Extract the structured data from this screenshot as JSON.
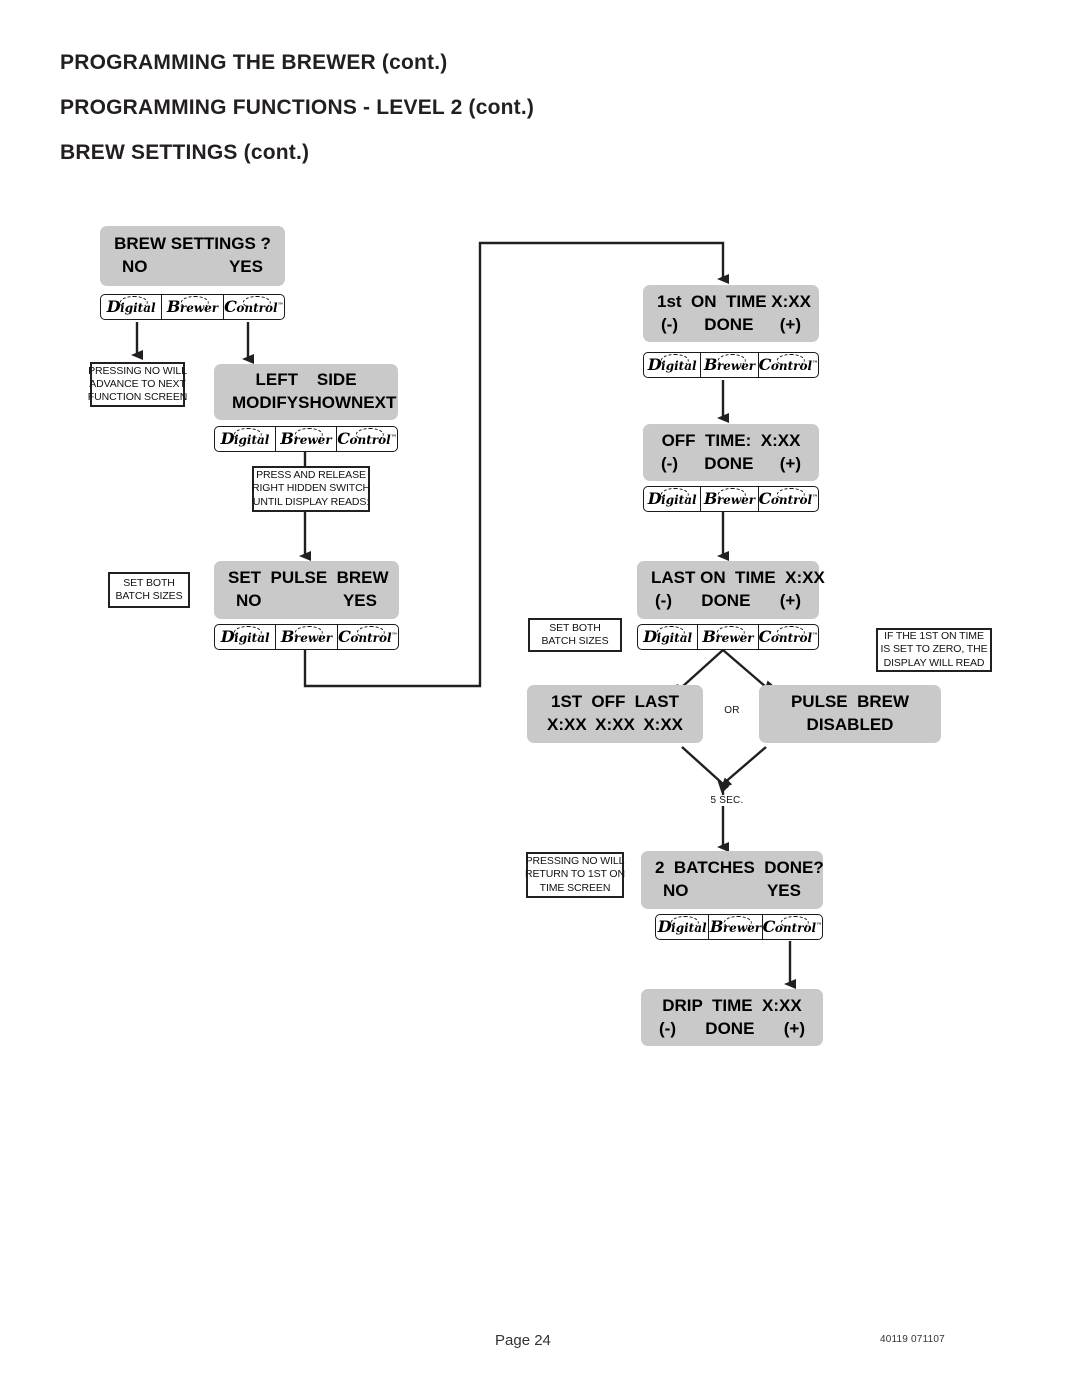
{
  "document": {
    "headings": [
      "PROGRAMMING THE BREWER (cont.)",
      "PROGRAMMING FUNCTIONS - LEVEL  2 (cont.)",
      "BREW SETTINGS (cont.)"
    ],
    "footer": {
      "page_label": "Page 24",
      "doc_code": "40119 071107"
    }
  },
  "logo": {
    "word1_cap": "D",
    "word1_rest": "igital",
    "word2_cap": "B",
    "word2_rest": "rewer",
    "word3_cap": "C",
    "word3_rest": "ontrol",
    "tm": "™"
  },
  "screens": {
    "brew_settings": {
      "line1": "BREW SETTINGS ?",
      "left": "NO",
      "right": "YES"
    },
    "left_side": {
      "line1": "LEFT    SIDE",
      "opt1": "MODIFY",
      "opt2": "SHOW",
      "opt3": "NEXT"
    },
    "set_pulse_brew": {
      "line1": "SET  PULSE  BREW",
      "left": "NO",
      "right": "YES"
    },
    "first_on_time": {
      "line1": "1st  ON  TIME X:XX",
      "minus": "(-)",
      "done": "DONE",
      "plus": "(+)"
    },
    "off_time": {
      "line1": "OFF  TIME:  X:XX",
      "minus": "(-)",
      "done": "DONE",
      "plus": "(+)"
    },
    "last_on_time": {
      "line1": "LAST ON  TIME  X:XX",
      "minus": "(-)",
      "done": "DONE",
      "plus": "(+)"
    },
    "summary_times": {
      "h1": "1ST",
      "h2": "OFF",
      "h3": "LAST",
      "v1": "X:XX",
      "v2": "X:XX",
      "v3": "X:XX"
    },
    "pulse_brew_disabled": {
      "line1": "PULSE  BREW",
      "line2": "DISABLED"
    },
    "two_batches_done": {
      "line1": "2  BATCHES  DONE?",
      "left": "NO",
      "right": "YES"
    },
    "drip_time": {
      "line1": "DRIP  TIME  X:XX",
      "minus": "(-)",
      "done": "DONE",
      "plus": "(+)"
    }
  },
  "notes": {
    "pressing_no_advance": [
      "PRESSING NO WILL",
      "ADVANCE TO NEXT",
      "FUNCTION SCREEN"
    ],
    "press_release_switch": [
      "PRESS AND RELEASE",
      "RIGHT HIDDEN SWITCH",
      "UNTIL DISPLAY READS:"
    ],
    "set_both_batch_left": [
      "SET BOTH",
      "BATCH SIZES"
    ],
    "set_both_batch_right": [
      "SET BOTH",
      "BATCH SIZES"
    ],
    "if_first_on_time_zero": [
      "IF THE 1ST ON TIME",
      "IS SET TO ZERO, THE",
      "DISPLAY WILL READ"
    ],
    "pressing_no_return": [
      "PRESSING NO WILL",
      "RETURN TO 1ST ON",
      "TIME SCREEN"
    ]
  },
  "wire_labels": {
    "or": "OR",
    "five_sec": "5 SEC."
  },
  "colors": {
    "lcd_background": "#c9c9c9",
    "ink": "#231f20",
    "page_background": "#ffffff"
  }
}
